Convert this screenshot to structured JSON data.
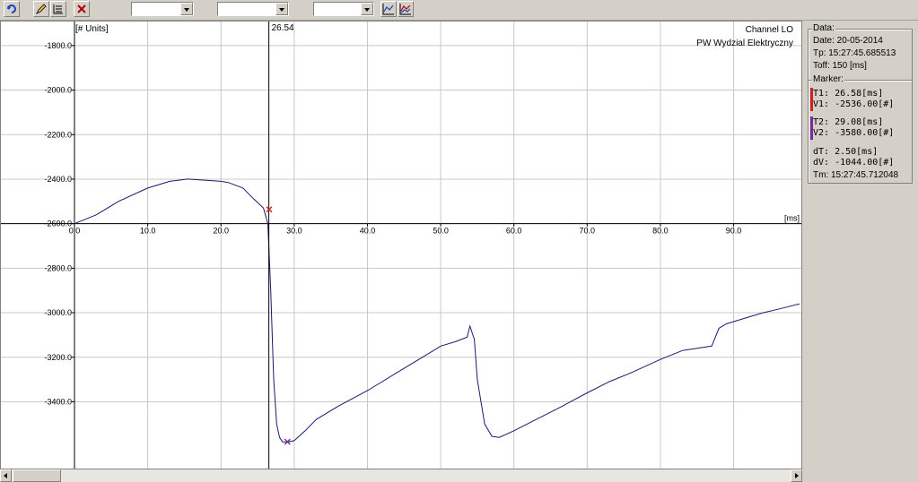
{
  "toolbar": {
    "buttons": [
      {
        "icon": "refresh-icon"
      },
      {
        "icon": "pen-icon"
      },
      {
        "icon": "list-icon"
      },
      {
        "icon": "close-icon"
      }
    ],
    "combos": [
      {
        "value": ""
      },
      {
        "value": ""
      },
      {
        "value": ""
      }
    ],
    "view_buttons": [
      {
        "icon": "line-view-icon"
      },
      {
        "icon": "area-view-icon"
      }
    ]
  },
  "chart_data": {
    "type": "line",
    "channel_label": "Channel LO",
    "subtitle": "PW Wydzial Elektryczny",
    "ylabel": "[# Units]",
    "xlabel": "[ms]",
    "xlim": [
      0,
      99
    ],
    "ylim": [
      -3700,
      -1700
    ],
    "x_ticks": [
      0,
      10,
      20,
      30,
      40,
      50,
      60,
      70,
      80,
      90
    ],
    "x_tick_labels": [
      "0.0",
      "10.0",
      "20.0",
      "30.0",
      "40.0",
      "50.0",
      "60.0",
      "70.0",
      "80.0",
      "90.0"
    ],
    "y_ticks": [
      -1800,
      -2000,
      -2200,
      -2400,
      -2600,
      -2800,
      -3000,
      -3200,
      -3400
    ],
    "y_tick_labels": [
      "-1800.0",
      "-2000.0",
      "-2200.0",
      "-2400.0",
      "-2600.0",
      "-2800.0",
      "-3000.0",
      "-3200.0",
      "-3400.0"
    ],
    "x_axis_at_y": -2600,
    "grid": true,
    "cursor": {
      "x": 26.54,
      "label": "26.54"
    },
    "series": [
      {
        "color": "#1a1a6e",
        "x": [
          0,
          3,
          6,
          10,
          13,
          15.5,
          18,
          20,
          21,
          23,
          24.5,
          25.8,
          26.4,
          26.8,
          27.2,
          27.6,
          28,
          28.4,
          29.08,
          30,
          31.5,
          33,
          36,
          40,
          44,
          48,
          50,
          52,
          53.6,
          54,
          54.6,
          55,
          56,
          57,
          58,
          60,
          63,
          66,
          70,
          73,
          76,
          80,
          83,
          85,
          87,
          88,
          89,
          90,
          92,
          94,
          96,
          99
        ],
        "y": [
          -2600,
          -2560,
          -2500,
          -2440,
          -2410,
          -2400,
          -2405,
          -2410,
          -2415,
          -2440,
          -2490,
          -2530,
          -2600,
          -2900,
          -3300,
          -3500,
          -3560,
          -3580,
          -3580,
          -3575,
          -3530,
          -3480,
          -3420,
          -3350,
          -3270,
          -3190,
          -3150,
          -3130,
          -3110,
          -3060,
          -3120,
          -3300,
          -3500,
          -3555,
          -3560,
          -3530,
          -3480,
          -3430,
          -3360,
          -3310,
          -3270,
          -3210,
          -3170,
          -3160,
          -3150,
          -3070,
          -3050,
          -3040,
          -3020,
          -3000,
          -2985,
          -2960
        ]
      }
    ],
    "markers": [
      {
        "x": 26.58,
        "y": -2536,
        "color": "#cc2222"
      },
      {
        "x": 29.08,
        "y": -3580,
        "color": "#7a2a9a"
      }
    ]
  },
  "panel": {
    "data_title": "Data:",
    "date": "Date:  20-05-2014",
    "tp": "Tp:  15:27:45.685513",
    "toff": "Toff: 150 [ms]",
    "marker_title": "Marker:",
    "t1": "T1:      26.58[ms]",
    "v1": "V1:   -2536.00[#]",
    "t2": "T2:      29.08[ms]",
    "v2": "V2:   -3580.00[#]",
    "dt": "dT:       2.50[ms]",
    "dv": "dV:   -1044.00[#]",
    "tm": "Tm:  15:27:45.712048",
    "marker1_color": "#cc2222",
    "marker2_color": "#7a2a9a"
  }
}
